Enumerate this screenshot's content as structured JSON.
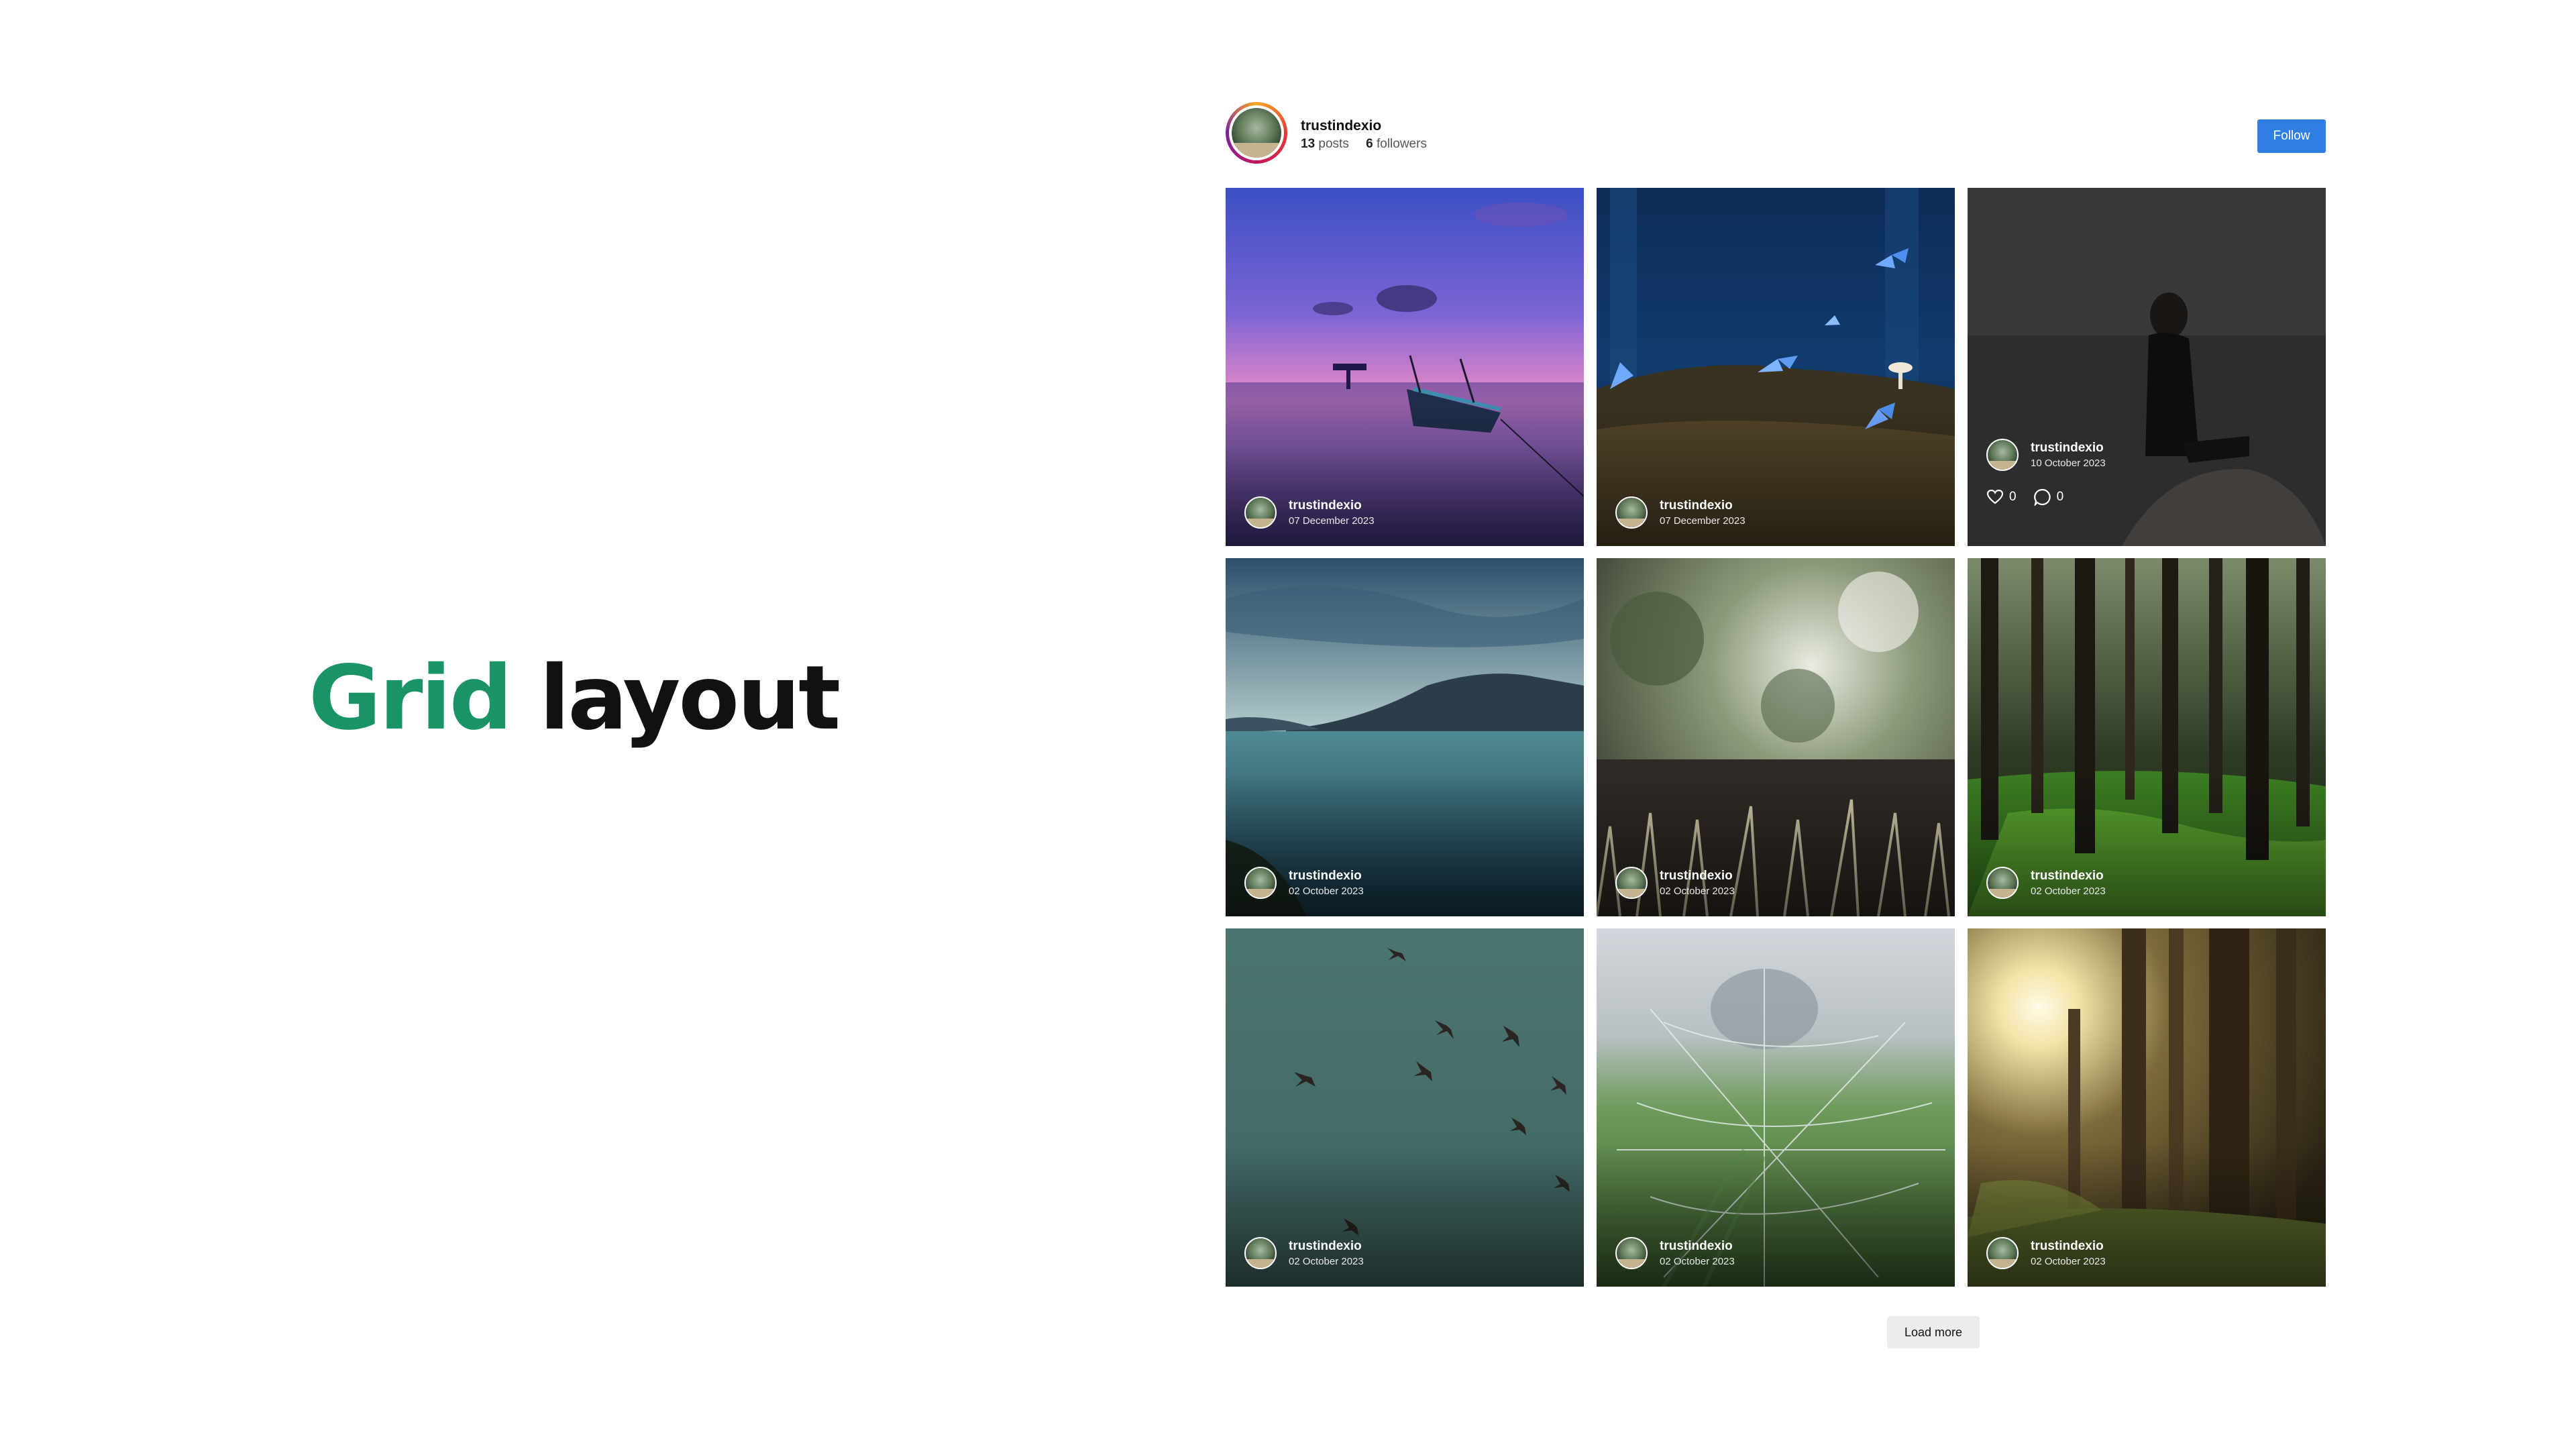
{
  "hero": {
    "accent_word": "Grid",
    "rest_word": " layout",
    "accent_color": "#1a9466"
  },
  "profile": {
    "username": "trustindexio",
    "posts_count": "13",
    "posts_label": "posts",
    "followers_count": "6",
    "followers_label": "followers",
    "follow_label": "Follow",
    "follow_color": "#2f7fe3"
  },
  "posts": [
    {
      "author": "trustindexio",
      "date": "07 December 2023",
      "scene": "sunset-lake-boat"
    },
    {
      "author": "trustindexio",
      "date": "07 December 2023",
      "scene": "blue-butterflies-forest"
    },
    {
      "author": "trustindexio",
      "date": "10 October 2023",
      "scene": "woman-sitting-on-rock",
      "hovered": true,
      "likes": "0",
      "comments": "0"
    },
    {
      "author": "trustindexio",
      "date": "02 October 2023",
      "scene": "mountain-lake"
    },
    {
      "author": "trustindexio",
      "date": "02 October 2023",
      "scene": "blurred-grass"
    },
    {
      "author": "trustindexio",
      "date": "02 October 2023",
      "scene": "mossy-forest"
    },
    {
      "author": "trustindexio",
      "date": "02 October 2023",
      "scene": "birds-in-sky"
    },
    {
      "author": "trustindexio",
      "date": "02 October 2023",
      "scene": "dewy-spiderweb"
    },
    {
      "author": "trustindexio",
      "date": "02 October 2023",
      "scene": "sunlit-forest"
    }
  ],
  "load_more_label": "Load more"
}
